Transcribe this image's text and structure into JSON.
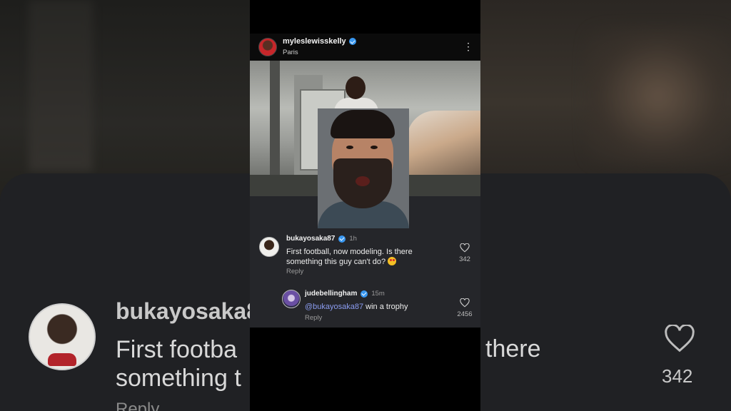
{
  "background": {
    "comment_username": "bukayosaka8",
    "comment_text_line1": "First footba",
    "comment_text_line2": "something t",
    "comment_text_right": "there",
    "reply_label": "Reply",
    "like_count": "342"
  },
  "post": {
    "username": "myleslewisskelly",
    "location": "Paris",
    "more_icon": "more-vertical-icon"
  },
  "comments": [
    {
      "username": "bukayosaka87",
      "time": "1h",
      "text": "First football, now modeling. Is there something this guy can't do?",
      "reply_label": "Reply",
      "like_count": "342"
    },
    {
      "username": "judebellingham",
      "time": "15m",
      "mention": "@bukayosaka87",
      "text": " win a trophy",
      "reply_label": "Reply",
      "like_count": "2456"
    }
  ],
  "colors": {
    "verified": "#3897f0",
    "mention": "#8b9cf0",
    "panel": "#25262a"
  }
}
